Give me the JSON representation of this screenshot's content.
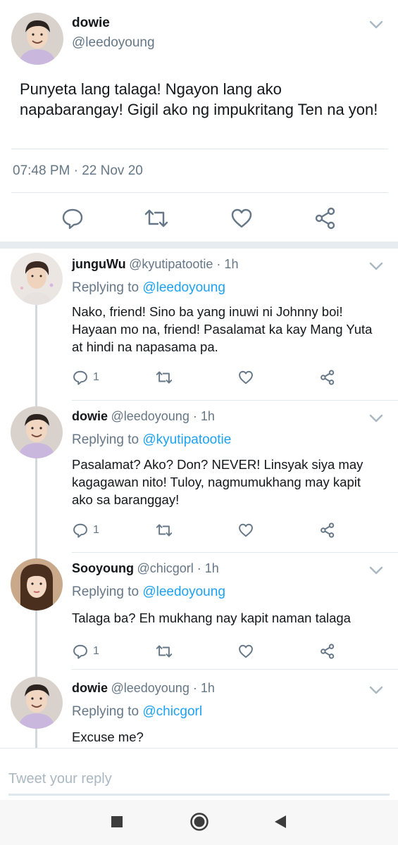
{
  "main_tweet": {
    "name": "dowie",
    "handle": "@leedoyoung",
    "text": "Punyeta lang talaga! Ngayon lang ako napabarangay! Gigil ako ng impukritang Ten na yon!",
    "timestamp": "07:48 PM · 22 Nov 20",
    "actions": [
      "reply-icon",
      "retweet-icon",
      "like-icon",
      "share-icon"
    ]
  },
  "replies": [
    {
      "name": "junguWu",
      "handle": "@kyutipatootie · 1h",
      "replying_prefix": "Replying to ",
      "replying_to": "@leedoyoung",
      "text": "Nako, friend! Sino ba yang inuwi ni Johnny boi! Hayaan mo na, friend! Pasalamat ka kay Mang Yuta at hindi na napasama pa.",
      "reply_count": "1"
    },
    {
      "name": "dowie",
      "handle": "@leedoyoung · 1h",
      "replying_prefix": "Replying to ",
      "replying_to": "@kyutipatootie",
      "text": "Pasalamat? Ako? Don? NEVER! Linsyak siya may kagagawan nito! Tuloy, nagmumukhang may kapit ako sa baranggay!",
      "reply_count": "1"
    },
    {
      "name": "Sooyoung",
      "handle": "@chicgorl · 1h",
      "replying_prefix": "Replying to ",
      "replying_to": "@leedoyoung",
      "text": "Talaga ba? Eh mukhang nay kapit naman talaga",
      "reply_count": "1"
    },
    {
      "name": "dowie",
      "handle": "@leedoyoung · 1h",
      "replying_prefix": "Replying to ",
      "replying_to": "@chicgorl",
      "text": "Excuse me?"
    }
  ],
  "compose": {
    "placeholder": "Tweet your reply"
  },
  "navbar": {
    "icons": [
      "recents-square-icon",
      "home-circle-icon",
      "back-triangle-icon"
    ]
  },
  "colors": {
    "link": "#1da1f2",
    "secondary": "#657786",
    "icon": "#657786",
    "divider": "#e1e8ed"
  }
}
